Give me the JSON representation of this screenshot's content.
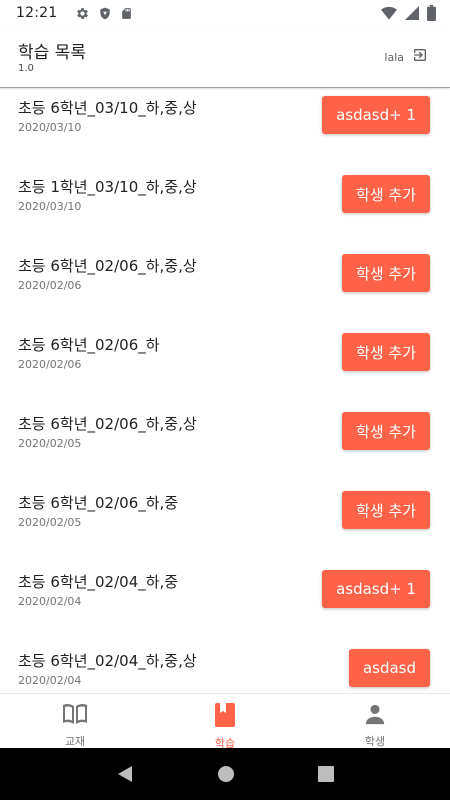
{
  "status_bar": {
    "time": "12:21",
    "icons": [
      "gear-icon",
      "shield-icon",
      "sd-card-icon",
      "wifi-icon",
      "signal-icon",
      "battery-icon"
    ]
  },
  "header": {
    "title": "학습 목록",
    "subtitle": "1.0",
    "account_name": "lala",
    "logout_icon": "logout-icon"
  },
  "items": [
    {
      "title": "초등 6학년_03/10_하,중,상",
      "date": "2020/03/10",
      "button": "asdasd+ 1"
    },
    {
      "title": "초등 1학년_03/10_하,중,상",
      "date": "2020/03/10",
      "button": "학생 추가"
    },
    {
      "title": "초등 6학년_02/06_하,중,상",
      "date": "2020/02/06",
      "button": "학생 추가"
    },
    {
      "title": "초등 6학년_02/06_하",
      "date": "2020/02/06",
      "button": "학생 추가"
    },
    {
      "title": "초등 6학년_02/06_하,중,상",
      "date": "2020/02/05",
      "button": "학생 추가"
    },
    {
      "title": "초등 6학년_02/06_하,중",
      "date": "2020/02/05",
      "button": "학생 추가"
    },
    {
      "title": "초등 6학년_02/04_하,중",
      "date": "2020/02/04",
      "button": "asdasd+ 1"
    },
    {
      "title": "초등 6학년_02/04_하,중,상",
      "date": "2020/02/04",
      "button": "asdasd"
    }
  ],
  "bottom_nav": {
    "tabs": [
      {
        "label": "교재",
        "icon": "book-icon",
        "active": false
      },
      {
        "label": "학습",
        "icon": "bookmark-book-icon",
        "active": true
      },
      {
        "label": "학생",
        "icon": "person-icon",
        "active": false
      }
    ]
  },
  "colors": {
    "accent": "#ff6347",
    "text_primary": "#212121",
    "text_secondary": "#757575",
    "nav_inactive": "#757575"
  }
}
